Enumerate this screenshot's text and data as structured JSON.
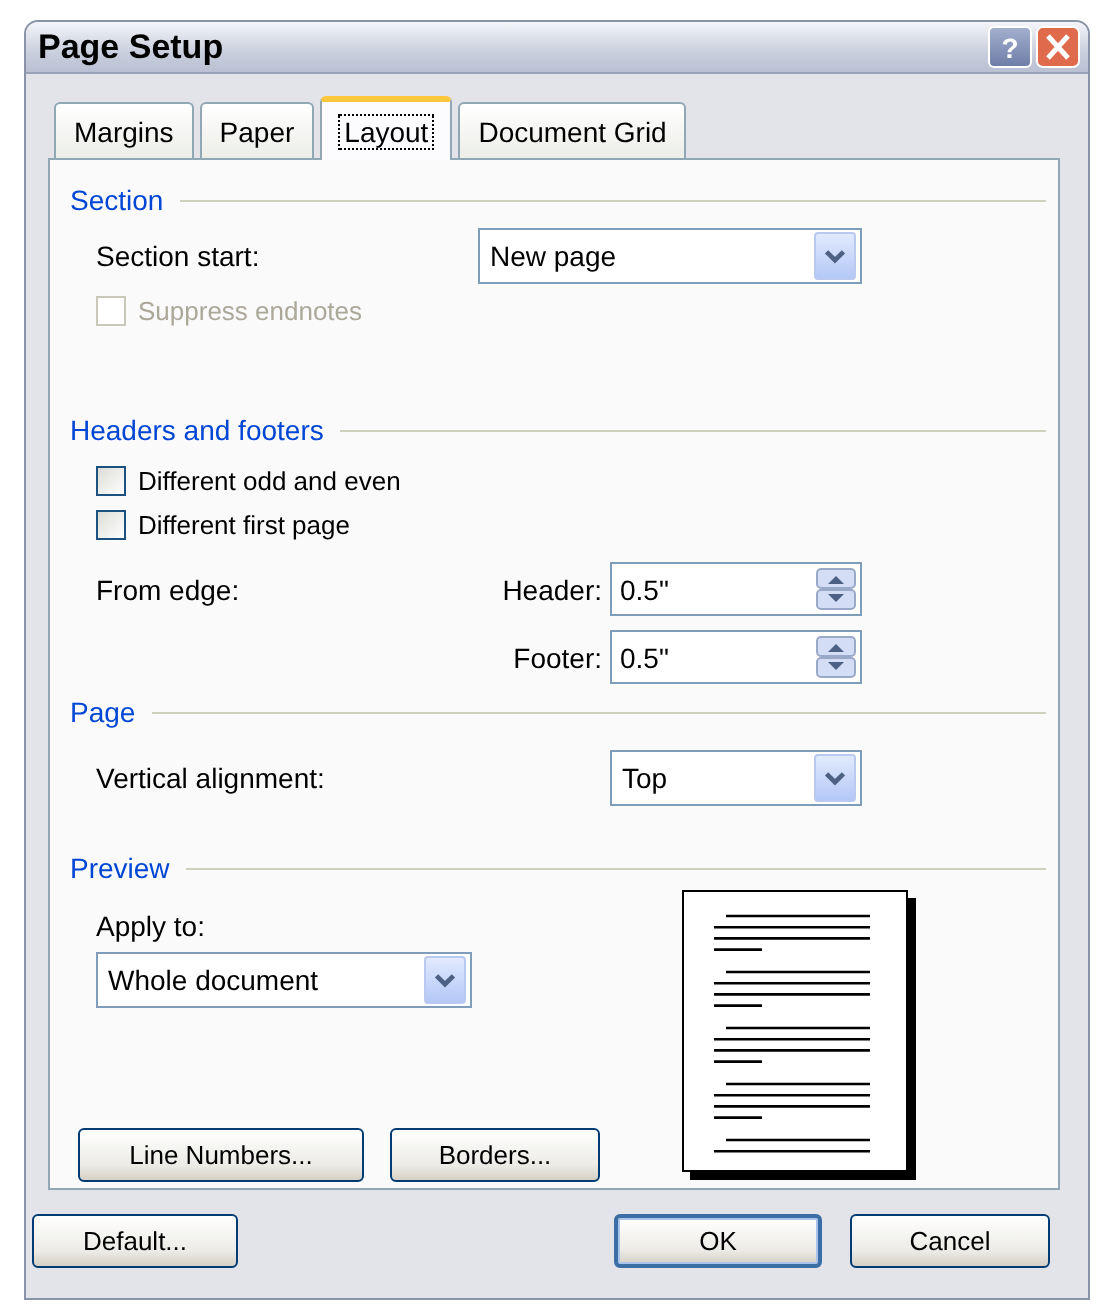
{
  "window": {
    "title": "Page Setup",
    "help_button": "?"
  },
  "tabs": [
    {
      "label": "Margins",
      "selected": false
    },
    {
      "label": "Paper",
      "selected": false
    },
    {
      "label": "Layout",
      "selected": true
    },
    {
      "label": "Document Grid",
      "selected": false
    }
  ],
  "sections": [
    {
      "title": "Section",
      "rows": [
        {
          "kind": "select",
          "label": "Section start:",
          "value": "New page"
        },
        {
          "kind": "checkbox",
          "label": "Suppress endnotes",
          "checked": false,
          "disabled": true
        }
      ]
    },
    {
      "title": "Headers and footers",
      "rows": [
        {
          "kind": "checkbox",
          "label": "Different odd and even",
          "checked": false,
          "disabled": false
        },
        {
          "kind": "checkbox",
          "label": "Different first page",
          "checked": false,
          "disabled": false
        },
        {
          "kind": "spin",
          "label": "From edge:",
          "field_label": "Header:",
          "value": "0.5\""
        },
        {
          "kind": "spin",
          "field_label": "Footer:",
          "value": "0.5\""
        }
      ]
    },
    {
      "title": "Page",
      "rows": [
        {
          "kind": "select",
          "label": "Vertical alignment:",
          "value": "Top"
        }
      ]
    }
  ],
  "preview": {
    "title": "Preview",
    "apply_label": "Apply to:",
    "apply_value": "Whole document",
    "buttons": [
      "Line Numbers...",
      "Borders..."
    ]
  },
  "footer_buttons": [
    {
      "label": "Default...",
      "default": false
    },
    {
      "label": "OK",
      "default": true
    },
    {
      "label": "Cancel",
      "default": false
    }
  ]
}
